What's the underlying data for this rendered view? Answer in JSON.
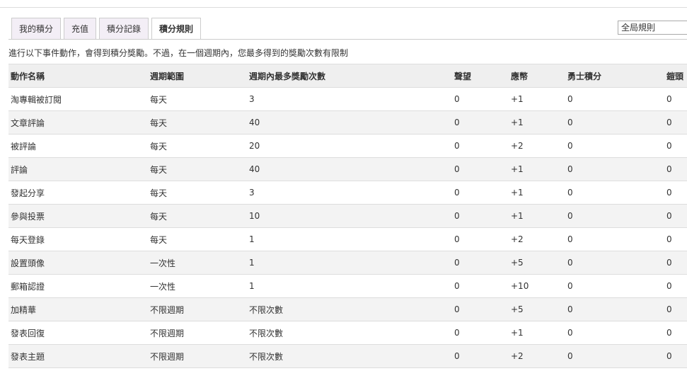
{
  "tabs": [
    {
      "label": "我的積分",
      "active": false
    },
    {
      "label": "充值",
      "active": false
    },
    {
      "label": "積分記錄",
      "active": false
    },
    {
      "label": "積分規則",
      "active": true
    }
  ],
  "scope_select": {
    "value": "全局規則"
  },
  "description": "進行以下事件動作，會得到積分獎勵。不過，在一個週期內，您最多得到的獎勵次數有限制",
  "table": {
    "headers": [
      "動作名稱",
      "週期範圍",
      "週期內最多獎勵次數",
      "聲望",
      "應幣",
      "勇士積分",
      "鎧頭"
    ],
    "rows": [
      [
        "淘專輯被訂閱",
        "每天",
        "3",
        "0",
        "+1",
        "0",
        "0"
      ],
      [
        "文章評論",
        "每天",
        "40",
        "0",
        "+1",
        "0",
        "0"
      ],
      [
        "被評論",
        "每天",
        "20",
        "0",
        "+2",
        "0",
        "0"
      ],
      [
        "評論",
        "每天",
        "40",
        "0",
        "+1",
        "0",
        "0"
      ],
      [
        "發起分享",
        "每天",
        "3",
        "0",
        "+1",
        "0",
        "0"
      ],
      [
        "參與投票",
        "每天",
        "10",
        "0",
        "+1",
        "0",
        "0"
      ],
      [
        "每天登錄",
        "每天",
        "1",
        "0",
        "+2",
        "0",
        "0"
      ],
      [
        "設置頭像",
        "一次性",
        "1",
        "0",
        "+5",
        "0",
        "0"
      ],
      [
        "郵箱認證",
        "一次性",
        "1",
        "0",
        "+10",
        "0",
        "0"
      ],
      [
        "加精華",
        "不限週期",
        "不限次數",
        "0",
        "+5",
        "0",
        "0"
      ],
      [
        "發表回復",
        "不限週期",
        "不限次數",
        "0",
        "+1",
        "0",
        "0"
      ],
      [
        "發表主題",
        "不限週期",
        "不限次數",
        "0",
        "+2",
        "0",
        "0"
      ]
    ]
  }
}
